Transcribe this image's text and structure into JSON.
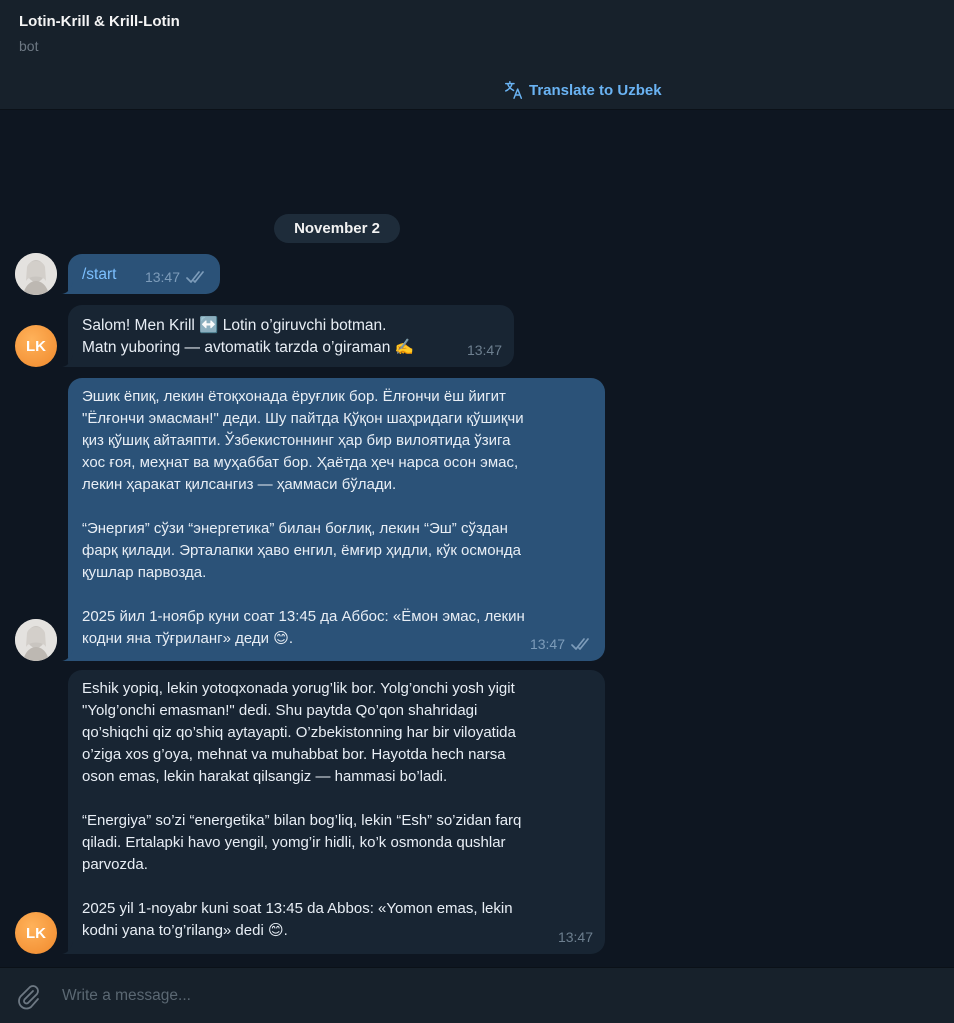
{
  "header": {
    "title": "Lotin-Krill & Krill-Lotin",
    "subtitle": "bot",
    "translate_label": "Translate to Uzbek"
  },
  "date_separator": "November 2",
  "messages": [
    {
      "direction": "out",
      "text": "/start",
      "time": "13:47",
      "read": true
    },
    {
      "direction": "in",
      "avatar_initials": "LK",
      "text": "Salom! Men Krill ↔️ Lotin o’giruvchi botman.\nMatn yuboring — avtomatik tarzda o’giraman ✍️",
      "time": "13:47"
    },
    {
      "direction": "out",
      "text": "Эшик ёпиқ, лекин ётоқхонада ёруғлик бор. Ёлғончи ёш йигит\n\"Ёлғончи эмасман!\" деди. Шу пайтда Қўқон шаҳридаги қўшиқчи\nқиз қўшиқ айтаяпти. Ўзбекистоннинг ҳар бир вилоятида ўзига\nхос ғоя, меҳнат ва муҳаббат бор. Ҳаётда ҳеч нарса осон эмас,\nлекин ҳаракат қилсангиз — ҳаммаси бўлади.\n\n“Энергия” сўзи “энергетика” билан боғлиқ, лекин “Эш” сўздан\nфарқ қилади. Эрталапки ҳаво енгил, ёмғир ҳидли, кўк осмонда\nқушлар парвозда.\n\n2025 йил 1-ноябр куни соат 13:45 да Аббос: «Ёмон эмас, лекин\nкодни яна тўғриланг» деди 😊.",
      "time": "13:47",
      "read": true
    },
    {
      "direction": "in",
      "avatar_initials": "LK",
      "text": "Eshik yopiq, lekin yotoqxonada yorug’lik bor. Yolg’onchi yosh yigit\n\"Yolg’onchi emasman!\" dedi. Shu paytda Qo’qon shahridagi\nqo’shiqchi qiz qo’shiq aytayapti. O’zbekistonning har bir viloyatida\no’ziga xos g’oya, mehnat va muhabbat bor. Hayotda hech narsa\noson emas, lekin harakat qilsangiz — hammasi bo’ladi.\n\n“Energiya” so’zi “energetika” bilan bog’liq, lekin “Esh” so’zidan farq\nqiladi. Ertalapki havo yengil, yomg’ir hidli, ko’k osmonda qushlar\nparvozda.\n\n2025 yil 1-noyabr kuni soat 13:45 da Abbos: «Yomon emas, lekin\nkodni yana to’g’rilang» dedi 😊.",
      "time": "13:47"
    }
  ],
  "composer": {
    "placeholder": "Write a message..."
  },
  "colors": {
    "background": "#0e1621",
    "header": "#17212b",
    "outgoing_bubble": "#2b5278",
    "incoming_bubble": "#182533",
    "accent": "#6ab3f3",
    "bot_avatar": "#f0892c"
  }
}
